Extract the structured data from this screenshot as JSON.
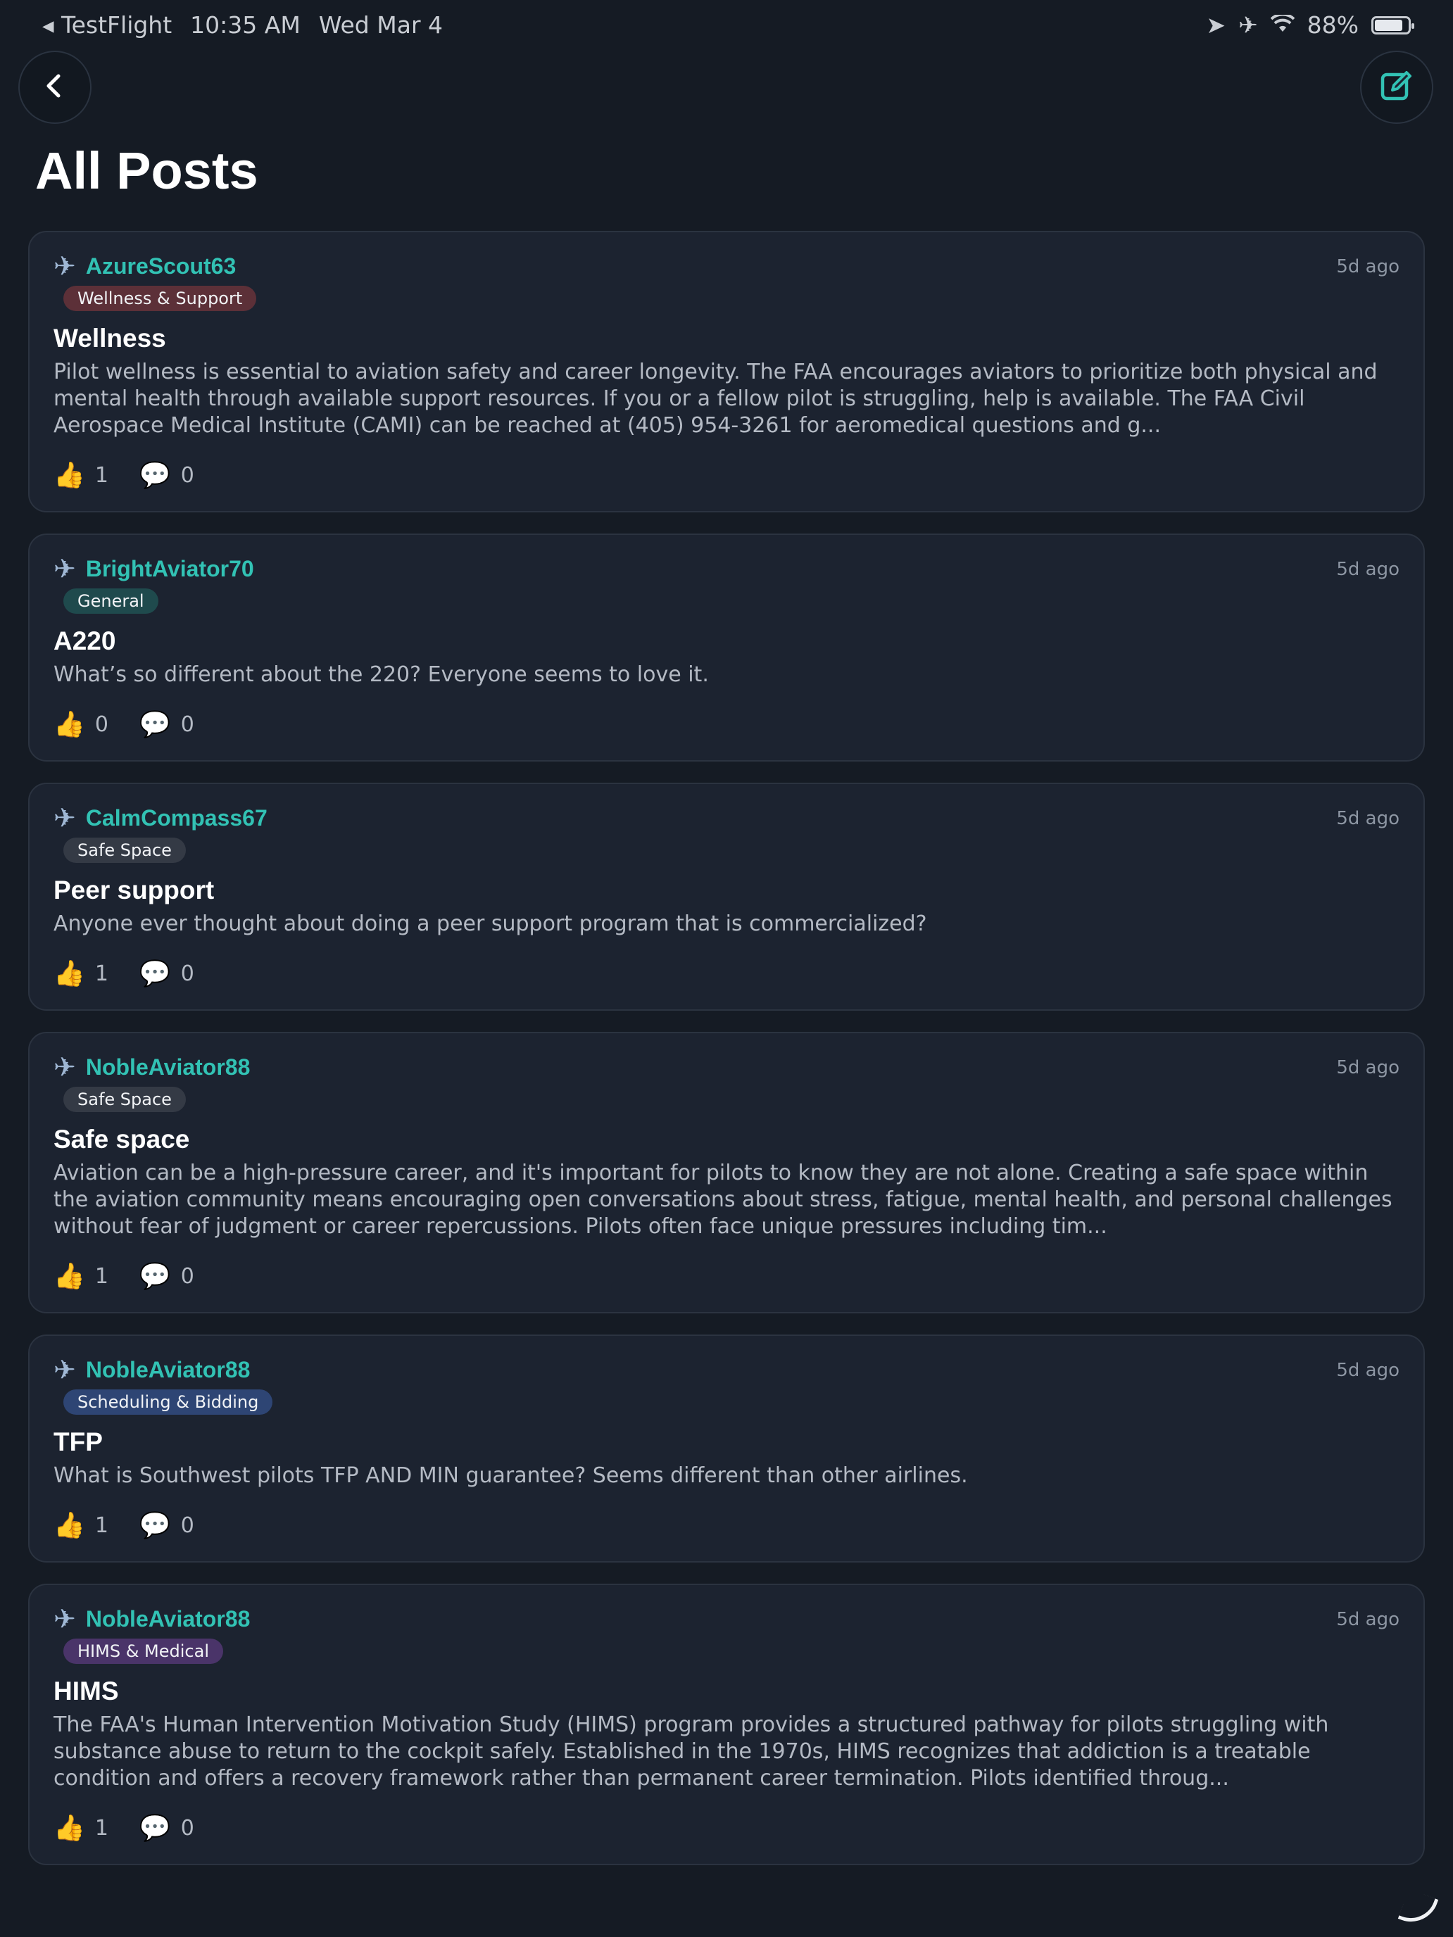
{
  "status_bar": {
    "back_app": "◂ TestFlight",
    "time": "10:35 AM",
    "date": "Wed Mar 4",
    "battery": "88%",
    "battery_level": 0.88,
    "icons": [
      "location-icon",
      "airplane-mode-icon",
      "wifi-icon",
      "battery-icon"
    ]
  },
  "header": {
    "title": "All Posts",
    "back_icon": "chevron-left-icon",
    "compose_icon": "compose-icon",
    "accent_color": "#32c2b4"
  },
  "posts": [
    {
      "author": "AzureScout63",
      "time": "5d ago",
      "tag": "Wellness & Support",
      "title": "Wellness",
      "body": "Pilot wellness is essential to aviation safety and career longevity. The FAA encourages aviators to prioritize both physical and mental health through available support resources. If you or a fellow pilot is struggling, help is available. The FAA Civil Aerospace Medical Institute (CAMI) can be reached at (405) 954-3261 for aeromedical questions and g...",
      "likes": "1",
      "comments": "0"
    },
    {
      "author": "BrightAviator70",
      "time": "5d ago",
      "tag": "General",
      "title": "A220",
      "body": "What’s so different about the 220? Everyone seems to love it.",
      "likes": "0",
      "comments": "0"
    },
    {
      "author": "CalmCompass67",
      "time": "5d ago",
      "tag": "Safe Space",
      "title": "Peer support",
      "body": "Anyone ever thought about doing a peer support program that is commercialized?",
      "likes": "1",
      "comments": "0"
    },
    {
      "author": "NobleAviator88",
      "time": "5d ago",
      "tag": "Safe Space",
      "title": "Safe space",
      "body": "Aviation can be a high-pressure career, and it's important for pilots to know they are not alone. Creating a safe space within the aviation community means encouraging open conversations about stress, fatigue, mental health, and personal challenges without fear of judgment or career repercussions. Pilots often face unique pressures including tim...",
      "likes": "1",
      "comments": "0"
    },
    {
      "author": "NobleAviator88",
      "time": "5d ago",
      "tag": "Scheduling & Bidding",
      "title": "TFP",
      "body": "What is Southwest pilots TFP AND MIN guarantee? Seems different than other airlines.",
      "likes": "1",
      "comments": "0"
    },
    {
      "author": "NobleAviator88",
      "time": "5d ago",
      "tag": "HIMS & Medical",
      "title": "HIMS",
      "body": "The FAA's Human Intervention Motivation Study (HIMS) program provides a structured pathway for pilots struggling with substance abuse to return to the cockpit safely. Established in the 1970s, HIMS recognizes that addiction is a treatable condition and offers a recovery framework rather than permanent career termination. Pilots identified throug...",
      "likes": "1",
      "comments": "0"
    }
  ],
  "post_icons": {
    "author": "airplane-icon",
    "like": "thumbs-up-icon",
    "comment": "speech-bubble-icon"
  }
}
